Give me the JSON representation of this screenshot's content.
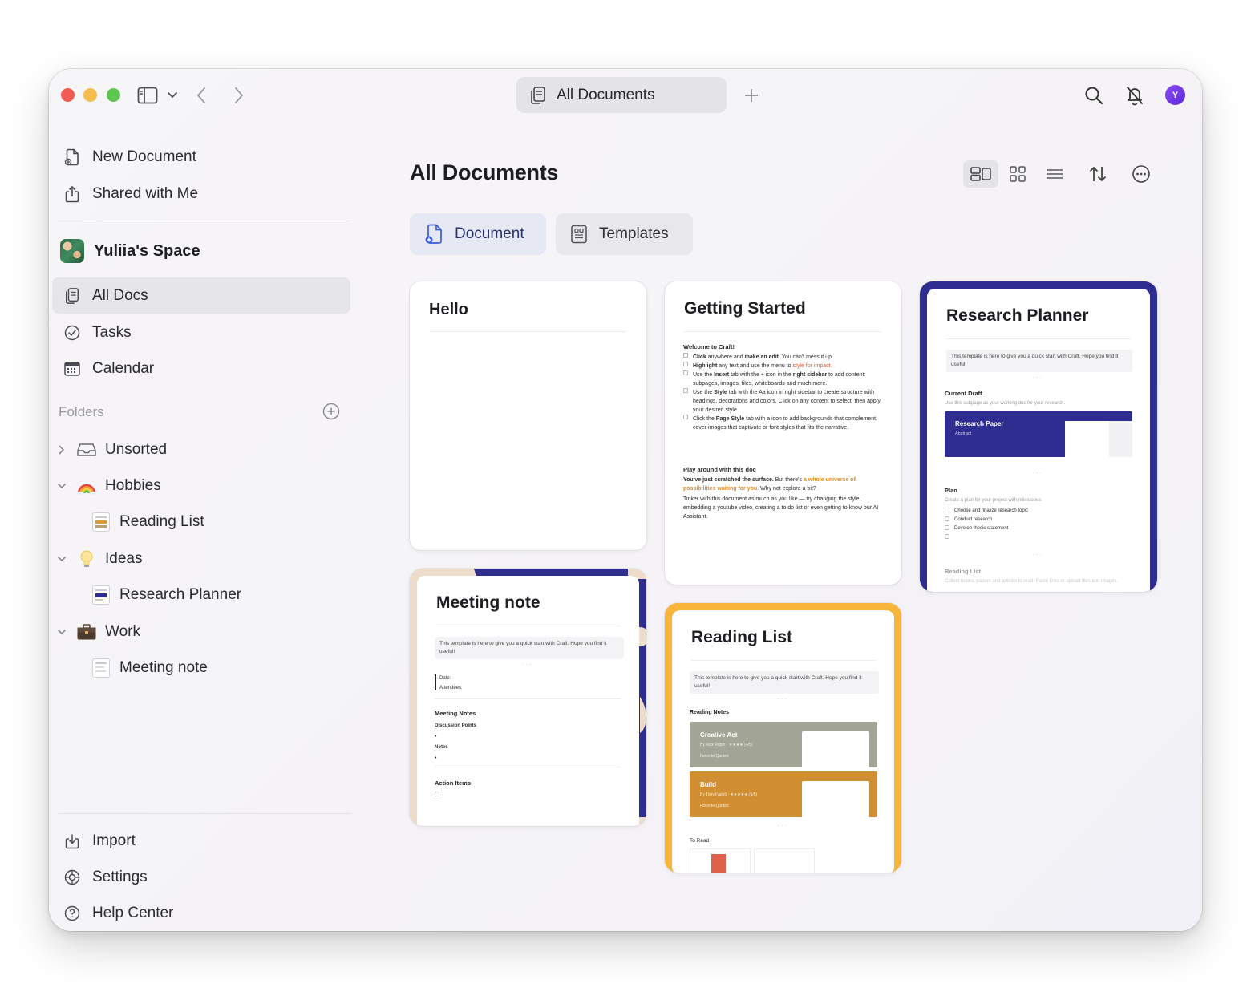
{
  "window": {
    "tab_title": "All Documents"
  },
  "sidebar": {
    "top_items": [
      {
        "label": "New Document",
        "icon": "new-document-icon"
      },
      {
        "label": "Shared with Me",
        "icon": "share-icon"
      }
    ],
    "space_name": "Yuliia's Space",
    "nav_items": [
      {
        "label": "All Docs",
        "icon": "all-docs-icon",
        "active": true
      },
      {
        "label": "Tasks",
        "icon": "tasks-icon"
      },
      {
        "label": "Calendar",
        "icon": "calendar-icon"
      }
    ],
    "folders_label": "Folders",
    "folders": [
      {
        "label": "Unsorted",
        "expanded": false
      },
      {
        "label": "Hobbies",
        "expanded": true,
        "children": [
          "Reading List"
        ]
      },
      {
        "label": "Ideas",
        "expanded": true,
        "children": [
          "Research Planner"
        ]
      },
      {
        "label": "Work",
        "expanded": true,
        "children": [
          "Meeting note"
        ]
      }
    ],
    "bottom_items": [
      {
        "label": "Import",
        "icon": "import-icon"
      },
      {
        "label": "Settings",
        "icon": "settings-icon"
      },
      {
        "label": "Help Center",
        "icon": "help-icon"
      }
    ]
  },
  "main": {
    "title": "All Documents",
    "tabs": [
      {
        "label": "Document",
        "active": true
      },
      {
        "label": "Templates",
        "active": false
      }
    ],
    "cards": {
      "hello": {
        "title": "Hello"
      },
      "getting_started": {
        "title": "Getting Started",
        "welcome": "Welcome to Craft!",
        "items": [
          {
            "bold": "Click",
            "text1": " anywhere and ",
            "bold2": "make an edit",
            "text2": ". You can't mess it up."
          },
          {
            "bold": "Highlight",
            "text1": " any text and use the menu to ",
            "hl": "style for impact."
          },
          {
            "pre": "Use the ",
            "bold": "Insert",
            "text1": " tab with the + icon in the ",
            "bold2": "right sidebar",
            "text2": " to add content: subpages, images, files, whiteboards and much more."
          },
          {
            "pre": "Use the ",
            "bold": "Style",
            "text1": " tab with the Aa icon in right sidebar to create structure with headings, decorations and colors. Click on any content to select, then apply your desired style."
          },
          {
            "pre": "Click the ",
            "bold": "Page Style",
            "text1": " tab with a icon to add backgrounds that complement, cover images that captivate or font styles that fits the narrative."
          }
        ],
        "play_head": "Play around with this doc",
        "play_bold": "You've just scratched the surface.",
        "play_mid": " But there's ",
        "play_orange": "a whole universe of possibilities waiting for you.",
        "play_end": " Why not explore a bit?",
        "tinker": "Tinker with this document as much as you like — try changing the style, embedding a youtube video, creating a to do list or even getting to know our AI Assistant."
      },
      "research": {
        "title": "Research Planner",
        "intro": "This template is here to give you a quick start with Craft. Hope you find it useful!",
        "current_draft": "Current Draft",
        "current_draft_sub": "Use this subpage as your working doc for your research.",
        "paper_title": "Research Paper",
        "paper_sub": "Abstract",
        "plan": "Plan",
        "plan_sub": "Create a plan for your project with milestones",
        "plan_items": [
          "Choose and finalize research topic",
          "Conduct research",
          "Develop thesis statement"
        ],
        "reading_list": "Reading List",
        "reading_list_sub": "Collect books, papers and articles to read. Paste links or upload files and images."
      },
      "meeting": {
        "title": "Meeting note",
        "intro": "This template is here to give you a quick start with Craft. Hope you find it useful!",
        "date": "Date:",
        "attendees": "Attendees:",
        "meeting_notes": "Meeting Notes",
        "discussion": "Discussion Points",
        "notes": "Notes",
        "action_items": "Action Items"
      },
      "reading": {
        "title": "Reading List",
        "intro": "This template is here to give you a quick start with Craft. Hope you find it useful!",
        "reading_notes": "Reading Notes",
        "book1": "Creative Act",
        "book1_by": "By Rick Rubin · ★★★★ (4/5)",
        "book1_q": "Favorite Quotes",
        "book2": "Build",
        "book2_by": "By Tony Fadell · ★★★★★ (5/5)",
        "book2_q": "Favorite Quotes",
        "to_read": "To Read"
      }
    }
  },
  "colors": {
    "accent_navy": "#2f2d8f",
    "reading_orange": "#f7b53b",
    "meeting_beige": "#ecdcc9"
  }
}
